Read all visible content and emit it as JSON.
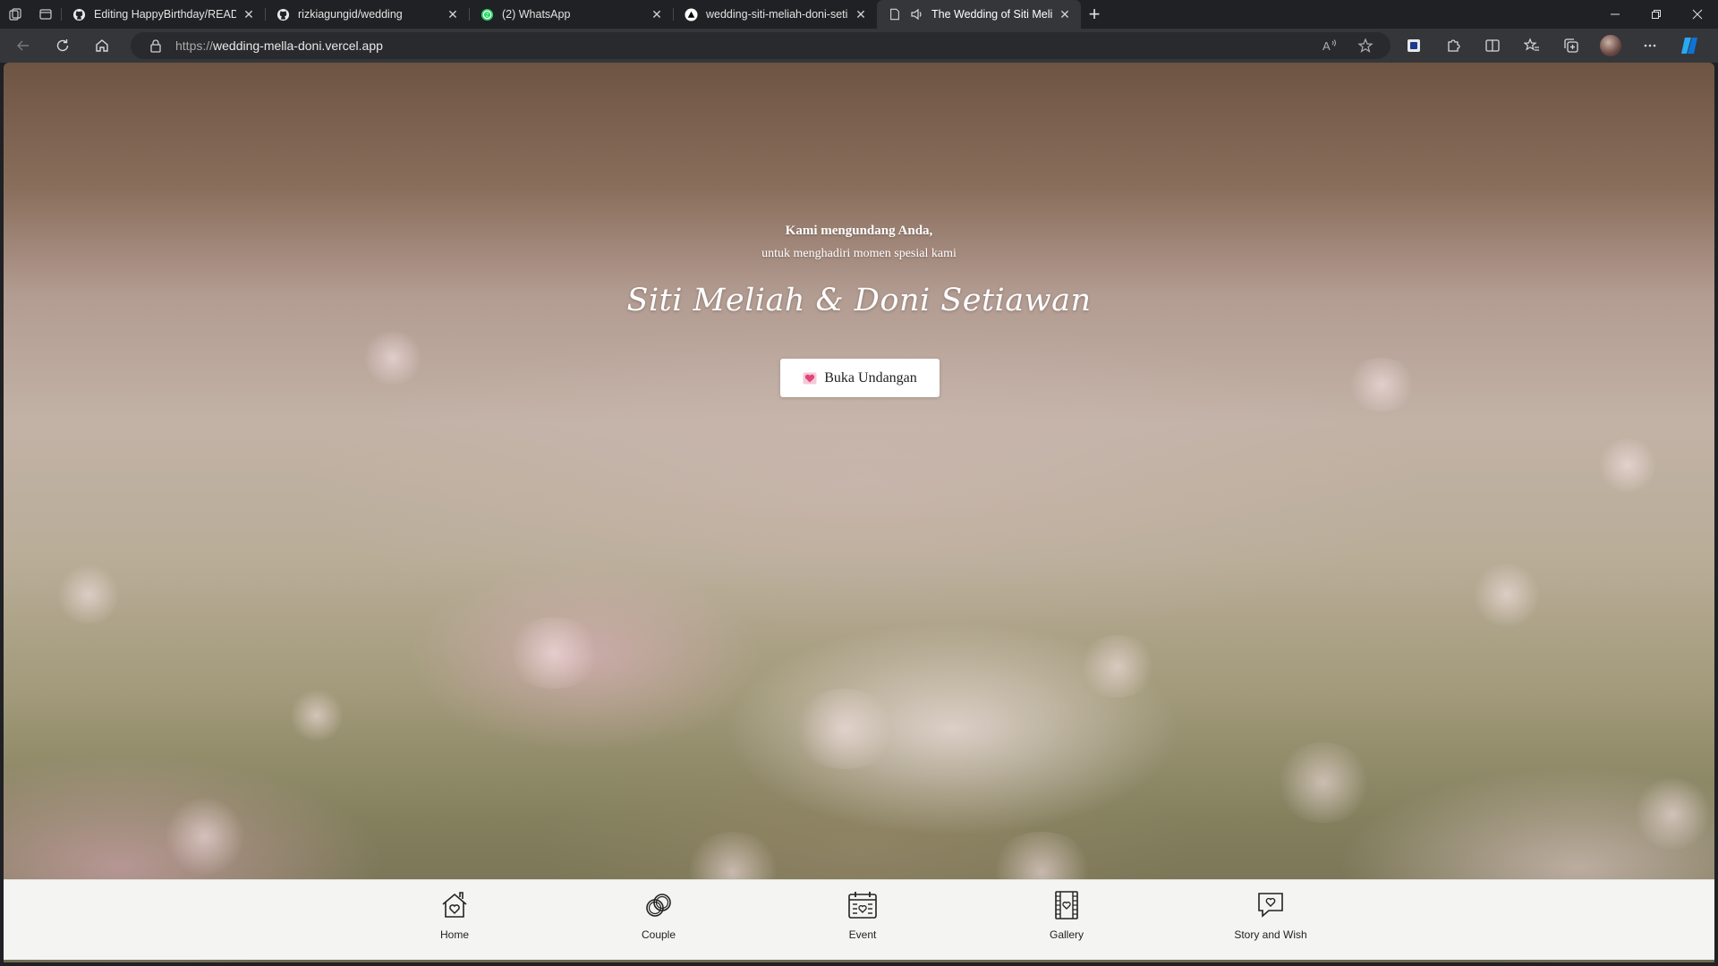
{
  "browser": {
    "tabs": [
      {
        "title": "Editing HappyBirthday/README",
        "favicon": "github-icon",
        "active": false
      },
      {
        "title": "rizkiagungid/wedding",
        "favicon": "github-icon",
        "active": false
      },
      {
        "title": "(2) WhatsApp",
        "favicon": "whatsapp-icon",
        "active": false
      },
      {
        "title": "wedding-siti-meliah-doni-setiaw",
        "favicon": "vercel-icon",
        "active": false
      },
      {
        "title": "The Wedding of Siti Meliah",
        "favicon": "page-icon",
        "active": true
      }
    ],
    "url_scheme": "https://",
    "url_host": "wedding-mella-doni.vercel.app"
  },
  "hero": {
    "greeting": "Kami mengundang Anda,",
    "subtitle": "untuk menghadiri momen spesial kami",
    "couple_names": "Siti Meliah & Doni Setiawan",
    "open_button_label": "Buka Undangan"
  },
  "bottom_nav": {
    "items": [
      {
        "label": "Home",
        "icon": "home-heart-icon"
      },
      {
        "label": "Couple",
        "icon": "rings-icon"
      },
      {
        "label": "Event",
        "icon": "calendar-icon"
      },
      {
        "label": "Gallery",
        "icon": "film-gallery-icon"
      },
      {
        "label": "Story and Wish",
        "icon": "chat-heart-icon"
      }
    ]
  },
  "colors": {
    "browser_frame": "#202124",
    "toolbar": "#35363a",
    "button_bg": "#ffffff",
    "nav_bg": "#f4f4f2",
    "heart": "#e0457b"
  }
}
